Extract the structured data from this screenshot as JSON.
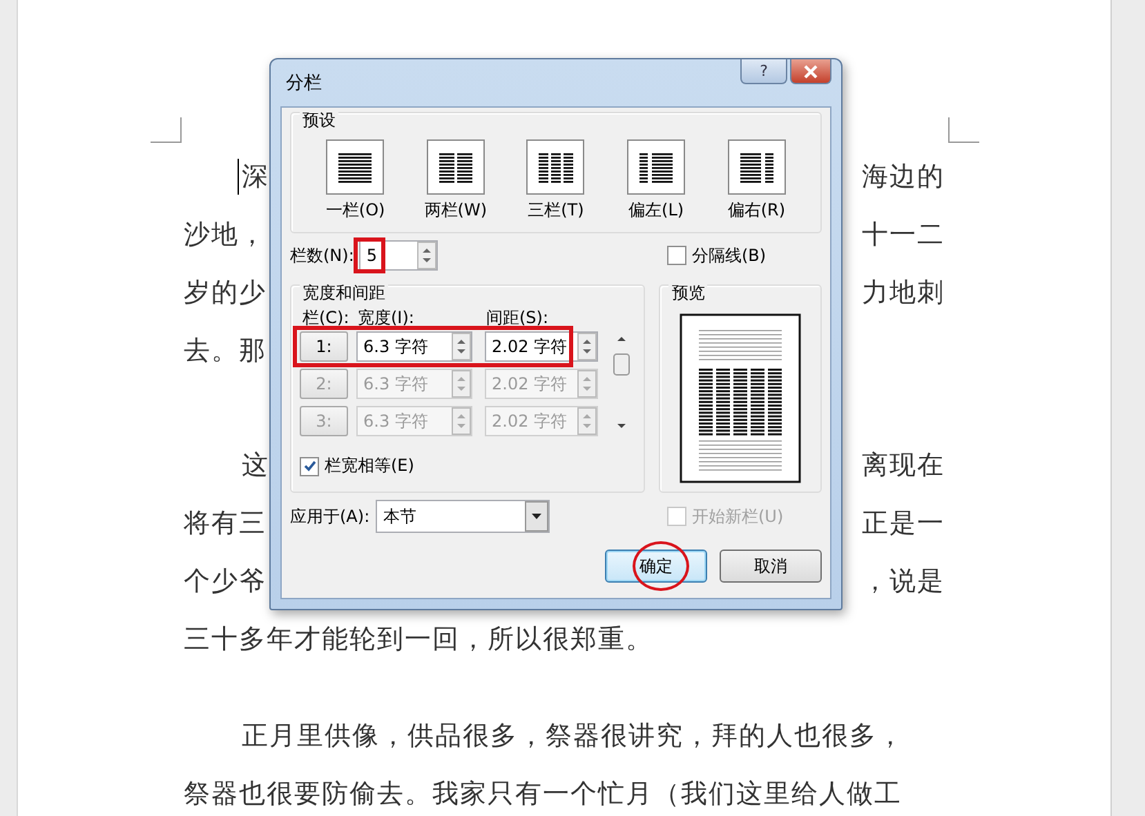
{
  "document": {
    "paragraphs": [
      {
        "lines": [
          {
            "kind": "split",
            "left": "深",
            "right": "海边的"
          },
          {
            "kind": "split",
            "left": "沙地，",
            "right": "十一二"
          },
          {
            "kind": "split",
            "left": "岁的少",
            "right": "力地刺"
          },
          {
            "kind": "split",
            "left": "去。那"
          }
        ]
      },
      {
        "lines": [
          {
            "kind": "split",
            "left": "这",
            "right": "离现在"
          },
          {
            "kind": "split",
            "left": "将有三",
            "right": "正是一"
          },
          {
            "kind": "split",
            "left": "个少爷",
            "right": "，说是"
          },
          {
            "kind": "full",
            "text": "三十多年才能轮到一回，所以很郑重。"
          }
        ]
      },
      {
        "lines": [
          {
            "kind": "full",
            "text": "正月里供像，供品很多，祭器很讲究，拜的人也很多，"
          },
          {
            "kind": "full",
            "text": "祭器也很要防偷去。我家只有一个忙月（我们这里给人做工"
          }
        ]
      }
    ]
  },
  "dialog": {
    "title": "分栏",
    "help": "?",
    "presets": {
      "label": "预设",
      "items": [
        {
          "kind": "one",
          "label": "一栏(O)"
        },
        {
          "kind": "two",
          "label": "两栏(W)"
        },
        {
          "kind": "three",
          "label": "三栏(T)"
        },
        {
          "kind": "left",
          "label": "偏左(L)"
        },
        {
          "kind": "right",
          "label": "偏右(R)"
        }
      ]
    },
    "column_count": {
      "label": "栏数(N):",
      "value": "5"
    },
    "separator_line": {
      "label": "分隔线(B)",
      "checked": false,
      "disabled": false
    },
    "width_spacing": {
      "label": "宽度和间距",
      "headers": [
        "栏(C):",
        "宽度(I):",
        "间距(S):"
      ],
      "rows": [
        {
          "number": "1:",
          "width": "6.3 字符",
          "spacing": "2.02 字符",
          "disabled": false
        },
        {
          "number": "2:",
          "width": "6.3 字符",
          "spacing": "2.02 字符",
          "disabled": true
        },
        {
          "number": "3:",
          "width": "6.3 字符",
          "spacing": "2.02 字符",
          "disabled": true
        }
      ]
    },
    "equal_width": {
      "label": "栏宽相等(E)",
      "checked": true,
      "disabled": false
    },
    "preview": {
      "label": "预览"
    },
    "apply_to": {
      "label": "应用于(A):",
      "value": "本节"
    },
    "start_new_column": {
      "label": "开始新栏(U)",
      "checked": false,
      "disabled": true
    },
    "buttons": [
      {
        "label": "确定",
        "default": true
      },
      {
        "label": "取消",
        "default": false
      }
    ]
  }
}
